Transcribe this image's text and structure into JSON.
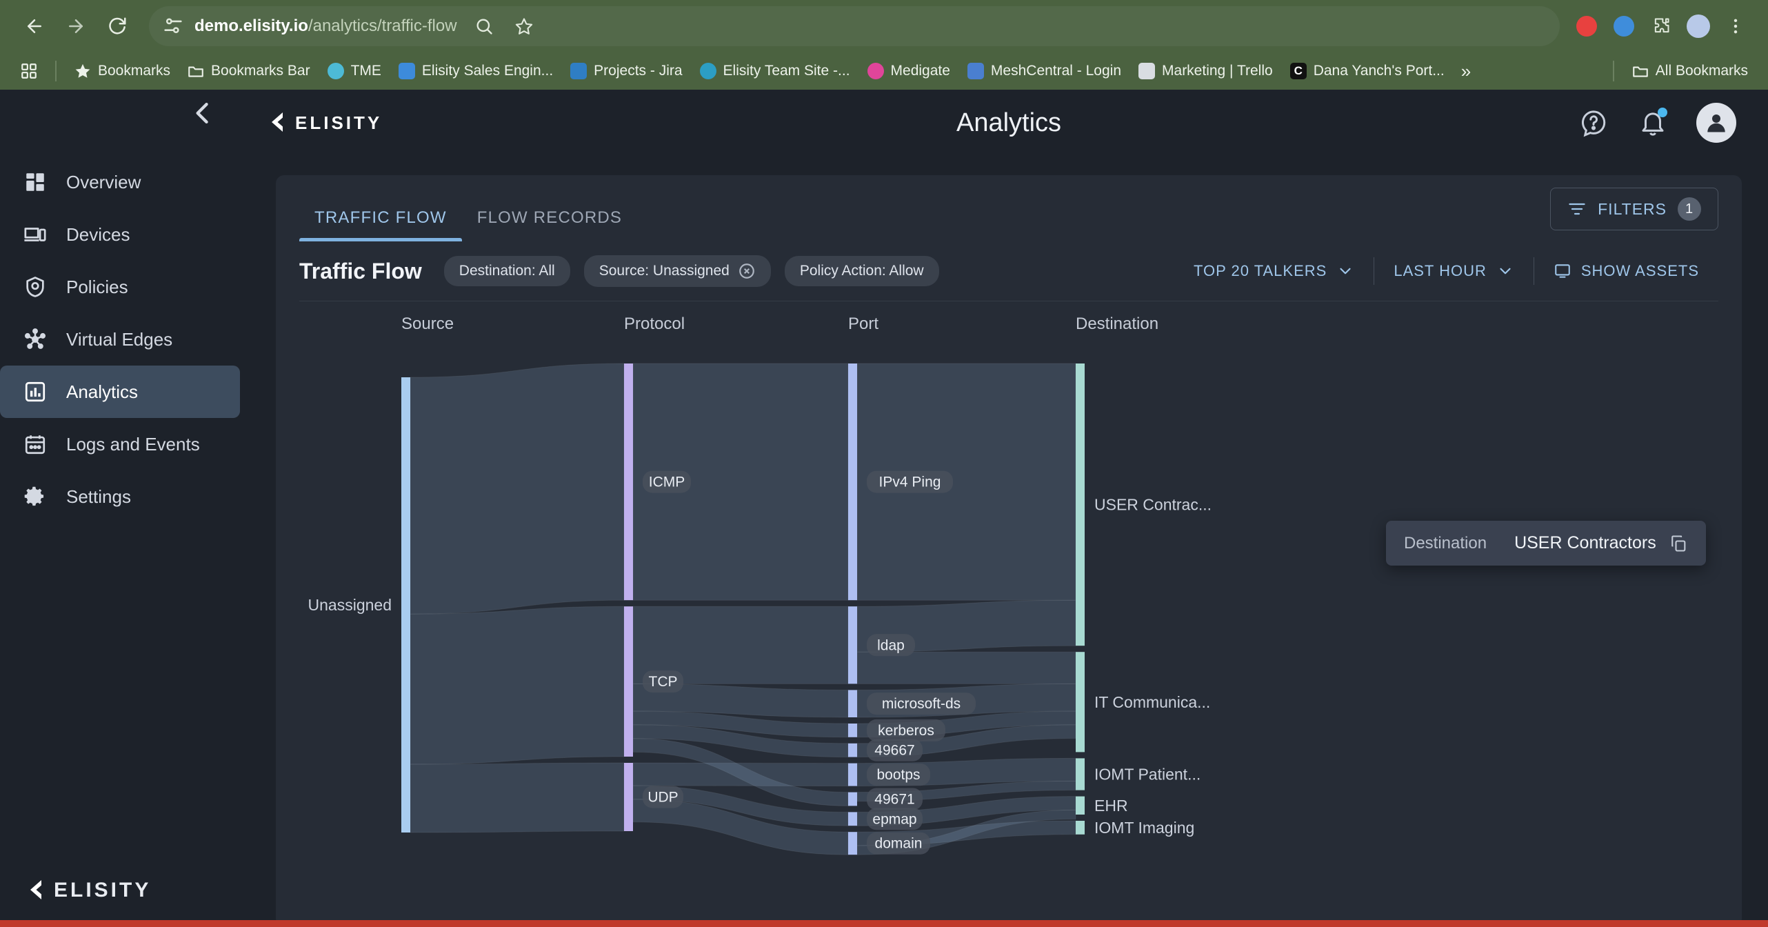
{
  "browser": {
    "nav": {
      "back": "back-arrow",
      "forward": "forward-arrow",
      "reload": "reload"
    },
    "url_prefix": "demo.elisity.io",
    "url_suffix": "/analytics/traffic-flow",
    "bookmarks": [
      {
        "label": "Bookmarks",
        "icon": "star-icon",
        "color": "#e8eee4"
      },
      {
        "label": "Bookmarks Bar",
        "icon": "folder-icon",
        "color": "#e8eee4"
      },
      {
        "label": "TME",
        "icon": "favicon-tme",
        "color": "#4dbad6"
      },
      {
        "label": "Elisity Sales Engin...",
        "icon": "favicon-x",
        "color": "#3d8bdb"
      },
      {
        "label": "Projects - Jira",
        "icon": "favicon-jira",
        "color": "#2f7ec4"
      },
      {
        "label": "Elisity Team Site -...",
        "icon": "favicon-sharepoint",
        "color": "#2c9ec4"
      },
      {
        "label": "Medigate",
        "icon": "favicon-medigate",
        "color": "#e0459a"
      },
      {
        "label": "MeshCentral - Login",
        "icon": "favicon-meshcentral",
        "color": "#4a7fd0"
      },
      {
        "label": "Marketing | Trello",
        "icon": "favicon-trello",
        "color": "#d9dde2"
      },
      {
        "label": "Dana Yanch's Port...",
        "icon": "favicon-c",
        "color": "#111111"
      }
    ],
    "overflow_label": "»",
    "all_bookmarks_label": "All Bookmarks"
  },
  "sidebar": {
    "collapse_icon": "chevron-left-icon",
    "items": [
      {
        "label": "Overview",
        "icon": "dashboard-icon",
        "active": false
      },
      {
        "label": "Devices",
        "icon": "devices-icon",
        "active": false
      },
      {
        "label": "Policies",
        "icon": "shield-icon",
        "active": false
      },
      {
        "label": "Virtual Edges",
        "icon": "network-icon",
        "active": false
      },
      {
        "label": "Analytics",
        "icon": "bar-chart-icon",
        "active": true
      },
      {
        "label": "Logs and Events",
        "icon": "calendar-icon",
        "active": false
      },
      {
        "label": "Settings",
        "icon": "gear-icon",
        "active": false
      }
    ],
    "logo_text": "ELISITY"
  },
  "header": {
    "brand": "ELISITY",
    "title": "Analytics",
    "help_icon": "help-circle-icon",
    "notifications_icon": "bell-icon",
    "avatar_icon": "user-avatar-icon"
  },
  "tabs": [
    {
      "label": "TRAFFIC FLOW",
      "active": true
    },
    {
      "label": "FLOW RECORDS",
      "active": false
    }
  ],
  "filters_button": {
    "label": "FILTERS",
    "badge": "1",
    "icon": "filter-icon"
  },
  "toolbar": {
    "title": "Traffic Flow",
    "chips": [
      {
        "label": "Destination: All",
        "removable": false
      },
      {
        "label": "Source: Unassigned",
        "removable": true
      },
      {
        "label": "Policy Action: Allow",
        "removable": false
      }
    ],
    "talkers_select": "TOP 20 TALKERS",
    "time_select": "LAST HOUR",
    "show_assets": "SHOW ASSETS",
    "show_assets_icon": "monitor-icon"
  },
  "tooltip": {
    "label": "Destination",
    "value": "USER Contractors",
    "copy_icon": "copy-icon"
  },
  "colors": {
    "source_node": "#a9cdf0",
    "protocol_node": "#c0b0ee",
    "port_node": "#aebff2",
    "destination_node": "#a8dad2",
    "link": "#8c93a3",
    "accent": "#7fb2e0",
    "card_bg": "#262c36",
    "browser_chrome": "#4b6240"
  },
  "chart_data": {
    "type": "sankey",
    "title": "Traffic Flow",
    "columns": [
      "Source",
      "Protocol",
      "Port",
      "Destination"
    ],
    "nodes": [
      {
        "id": "unassigned",
        "column": 0,
        "label": "Unassigned",
        "value": 100,
        "color": "#a9cdf0"
      },
      {
        "id": "icmp",
        "column": 1,
        "label": "ICMP",
        "value": 52,
        "color": "#c0b0ee"
      },
      {
        "id": "tcp",
        "column": 1,
        "label": "TCP",
        "value": 33,
        "color": "#c0b0ee"
      },
      {
        "id": "udp",
        "column": 1,
        "label": "UDP",
        "value": 15,
        "color": "#c0b0ee"
      },
      {
        "id": "ipv4ping",
        "column": 2,
        "label": "IPv4 Ping",
        "value": 52,
        "color": "#aebff2"
      },
      {
        "id": "ldap",
        "column": 2,
        "label": "ldap",
        "value": 17,
        "color": "#aebff2"
      },
      {
        "id": "microsoft-ds",
        "column": 2,
        "label": "microsoft-ds",
        "value": 6,
        "color": "#aebff2"
      },
      {
        "id": "kerberos",
        "column": 2,
        "label": "kerberos",
        "value": 3,
        "color": "#aebff2"
      },
      {
        "id": "49667",
        "column": 2,
        "label": "49667",
        "value": 3,
        "color": "#aebff2"
      },
      {
        "id": "bootps",
        "column": 2,
        "label": "bootps",
        "value": 5,
        "color": "#aebff2"
      },
      {
        "id": "49671",
        "column": 2,
        "label": "49671",
        "value": 3,
        "color": "#aebff2"
      },
      {
        "id": "epmap",
        "column": 2,
        "label": "epmap",
        "value": 3,
        "color": "#aebff2"
      },
      {
        "id": "domain",
        "column": 2,
        "label": "domain",
        "value": 5,
        "color": "#aebff2"
      },
      {
        "id": "user_contractors",
        "column": 3,
        "label": "USER Contrac...",
        "value": 62,
        "color": "#a8dad2"
      },
      {
        "id": "it_comm",
        "column": 3,
        "label": "IT Communica...",
        "value": 22,
        "color": "#a8dad2"
      },
      {
        "id": "iomt_patient",
        "column": 3,
        "label": "IOMT Patient...",
        "value": 7,
        "color": "#a8dad2"
      },
      {
        "id": "ehr",
        "column": 3,
        "label": "EHR",
        "value": 4,
        "color": "#a8dad2"
      },
      {
        "id": "iomt_imaging",
        "column": 3,
        "label": "IOMT Imaging",
        "value": 3,
        "color": "#a8dad2"
      }
    ],
    "links": [
      {
        "source": "unassigned",
        "target": "icmp",
        "value": 52
      },
      {
        "source": "unassigned",
        "target": "tcp",
        "value": 33
      },
      {
        "source": "unassigned",
        "target": "udp",
        "value": 15
      },
      {
        "source": "icmp",
        "target": "ipv4ping",
        "value": 52
      },
      {
        "source": "tcp",
        "target": "ldap",
        "value": 17
      },
      {
        "source": "tcp",
        "target": "microsoft-ds",
        "value": 6
      },
      {
        "source": "tcp",
        "target": "kerberos",
        "value": 3
      },
      {
        "source": "tcp",
        "target": "49667",
        "value": 3
      },
      {
        "source": "tcp",
        "target": "49671",
        "value": 3
      },
      {
        "source": "udp",
        "target": "bootps",
        "value": 5
      },
      {
        "source": "udp",
        "target": "epmap",
        "value": 3
      },
      {
        "source": "udp",
        "target": "domain",
        "value": 5
      },
      {
        "source": "ipv4ping",
        "target": "user_contractors",
        "value": 52
      },
      {
        "source": "ldap",
        "target": "user_contractors",
        "value": 10
      },
      {
        "source": "ldap",
        "target": "it_comm",
        "value": 7
      },
      {
        "source": "microsoft-ds",
        "target": "it_comm",
        "value": 6
      },
      {
        "source": "kerberos",
        "target": "it_comm",
        "value": 3
      },
      {
        "source": "49667",
        "target": "it_comm",
        "value": 3
      },
      {
        "source": "bootps",
        "target": "iomt_patient",
        "value": 5
      },
      {
        "source": "49671",
        "target": "iomt_patient",
        "value": 2
      },
      {
        "source": "epmap",
        "target": "ehr",
        "value": 3
      },
      {
        "source": "domain",
        "target": "iomt_imaging",
        "value": 3
      },
      {
        "source": "domain",
        "target": "ehr",
        "value": 2
      }
    ]
  }
}
